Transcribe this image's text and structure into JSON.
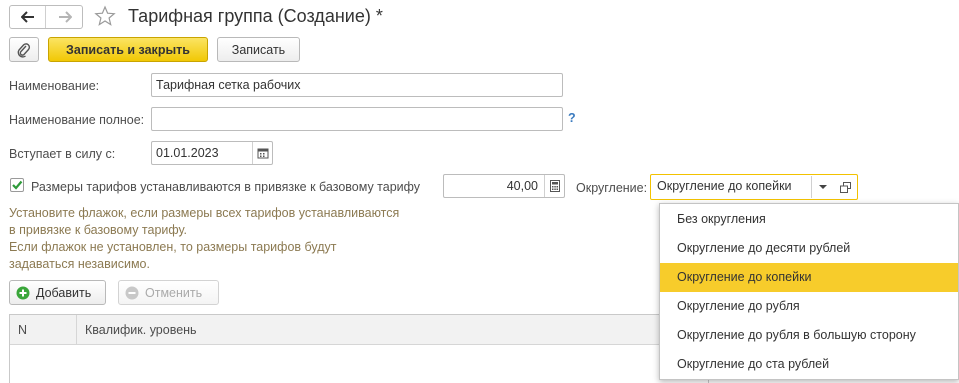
{
  "window": {
    "title": "Тарифная группа (Создание) *",
    "nav": {
      "back_icon": "arrow-left",
      "forward_icon": "arrow-right"
    },
    "favorite_icon": "star-outline"
  },
  "toolbar": {
    "attach_icon": "paperclip",
    "save_close_label": "Записать и закрыть",
    "save_label": "Записать"
  },
  "form": {
    "name_label": "Наименование:",
    "name_value": "Тарифная сетка рабочих",
    "fullname_label": "Наименование полное:",
    "fullname_value": "",
    "help_mark": "?",
    "effective_label": "Вступает в силу с:",
    "effective_value": "01.01.2023",
    "base_tariff_checkbox_label": "Размеры тарифов устанавливаются в привязке к базовому тарифу",
    "base_tariff_checked": true,
    "base_tariff_value": "40,00",
    "rounding_label": "Округление:",
    "rounding_value": "Округление до копейки",
    "hint_lines": [
      "Установите флажок, если размеры всех тарифов устанавливаются",
      "в привязке к базовому тарифу.",
      "Если флажок не установлен, то размеры тарифов будут",
      "задаваться независимо."
    ]
  },
  "table_toolbar": {
    "add_label": "Добавить",
    "cancel_label": "Отменить"
  },
  "table": {
    "columns": [
      "N",
      "Квалифик. уровень"
    ]
  },
  "dropdown": {
    "options": [
      "Без округления",
      "Округление до десяти рублей",
      "Округление до копейки",
      "Округление до рубля",
      "Округление до рубля в большую сторону",
      "Округление до ста рублей"
    ],
    "selected": "Округление до копейки"
  },
  "colors": {
    "accent_yellow": "#f1c805",
    "selected_item": "#f7cc2b",
    "focus_border": "#f2c200",
    "hint_text": "#8c7a52",
    "help_blue": "#3a7bbf",
    "add_green": "#3aa63a",
    "check_green": "#2e9b3a"
  }
}
